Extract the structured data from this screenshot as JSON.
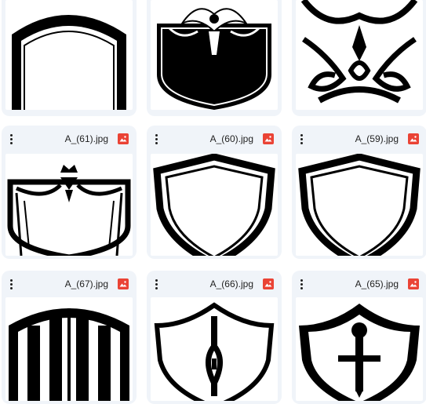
{
  "files": [
    {
      "name": "",
      "icon": "image-file-icon",
      "art": "shield-plain-outline"
    },
    {
      "name": "",
      "icon": "image-file-icon",
      "art": "shield-ornate-black"
    },
    {
      "name": "",
      "icon": "image-file-icon",
      "art": "shield-tribal"
    },
    {
      "name": "A_(61).jpg",
      "icon": "image-file-icon",
      "art": "shield-crown-curtain"
    },
    {
      "name": "A_(60).jpg",
      "icon": "image-file-icon",
      "art": "shield-double-outline"
    },
    {
      "name": "A_(59).jpg",
      "icon": "image-file-icon",
      "art": "shield-double-outline"
    },
    {
      "name": "A_(67).jpg",
      "icon": "image-file-icon",
      "art": "shield-stripes"
    },
    {
      "name": "A_(66).jpg",
      "icon": "image-file-icon",
      "art": "shield-key"
    },
    {
      "name": "A_(65).jpg",
      "icon": "image-file-icon",
      "art": "shield-sword"
    }
  ],
  "colors": {
    "card_bg": "#f0f4f9",
    "image_icon": "#ea4335",
    "text": "#1f1f1f"
  }
}
